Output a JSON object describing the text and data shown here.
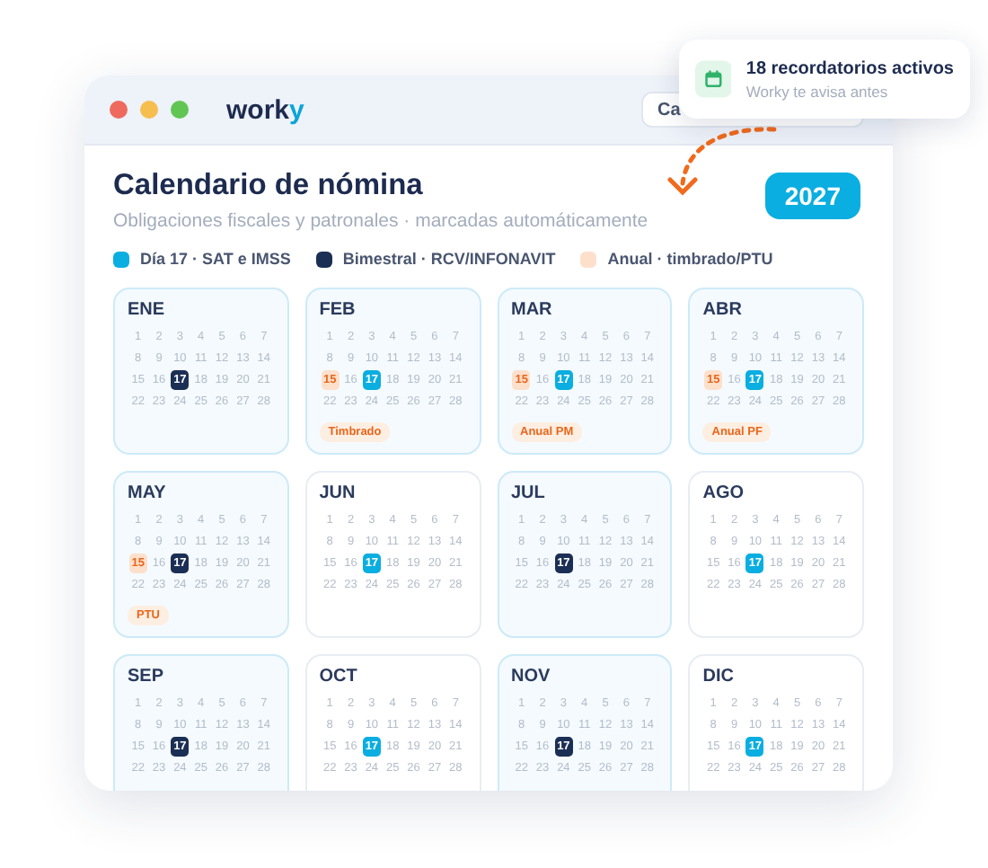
{
  "window": {
    "brand": "work",
    "brand_accent": "y",
    "search": {
      "value": "Ca"
    }
  },
  "toast": {
    "title": "18 recordatorios activos",
    "subtitle": "Worky te avisa antes"
  },
  "header": {
    "title": "Calendario de nómina",
    "subtitle": "Obligaciones fiscales y patronales · marcadas automáticamente",
    "year": "2027"
  },
  "legend": [
    {
      "kind": "monthly",
      "label": "Día 17 · SAT e IMSS"
    },
    {
      "kind": "bimestral",
      "label": "Bimestral · RCV/INFONAVIT"
    },
    {
      "kind": "annual",
      "label": "Anual · timbrado/PTU"
    }
  ],
  "months": [
    {
      "name": "ENE",
      "highlighted": true,
      "days": [
        "1",
        "2",
        "3",
        "4",
        "5",
        "6",
        "7",
        "8",
        "9",
        "10",
        "11",
        "12",
        "13",
        "14",
        "15",
        "16",
        {
          "day": "17",
          "kind": "bimestral"
        },
        "18",
        "19",
        "20",
        "21",
        "22",
        "23",
        "24",
        "25",
        "26",
        "27",
        "28"
      ]
    },
    {
      "name": "FEB",
      "highlighted": true,
      "tag": "Timbrado",
      "days": [
        "1",
        "2",
        "3",
        "4",
        "5",
        "6",
        "7",
        "8",
        "9",
        "10",
        "11",
        "12",
        "13",
        "14",
        {
          "day": "15",
          "kind": "annual"
        },
        "16",
        {
          "day": "17",
          "kind": "monthly"
        },
        "18",
        "19",
        "20",
        "21",
        "22",
        "23",
        "24",
        "25",
        "26",
        "27",
        "28"
      ]
    },
    {
      "name": "MAR",
      "highlighted": true,
      "tag": "Anual PM",
      "days": [
        "1",
        "2",
        "3",
        "4",
        "5",
        "6",
        "7",
        "8",
        "9",
        "10",
        "11",
        "12",
        "13",
        "14",
        {
          "day": "15",
          "kind": "annual"
        },
        "16",
        {
          "day": "17",
          "kind": "monthly"
        },
        "18",
        "19",
        "20",
        "21",
        "22",
        "23",
        "24",
        "25",
        "26",
        "27",
        "28"
      ]
    },
    {
      "name": "ABR",
      "highlighted": true,
      "tag": "Anual PF",
      "days": [
        "1",
        "2",
        "3",
        "4",
        "5",
        "6",
        "7",
        "8",
        "9",
        "10",
        "11",
        "12",
        "13",
        "14",
        {
          "day": "15",
          "kind": "annual"
        },
        "16",
        {
          "day": "17",
          "kind": "monthly"
        },
        "18",
        "19",
        "20",
        "21",
        "22",
        "23",
        "24",
        "25",
        "26",
        "27",
        "28"
      ]
    },
    {
      "name": "MAY",
      "highlighted": true,
      "tag": "PTU",
      "days": [
        "1",
        "2",
        "3",
        "4",
        "5",
        "6",
        "7",
        "8",
        "9",
        "10",
        "11",
        "12",
        "13",
        "14",
        {
          "day": "15",
          "kind": "annual"
        },
        "16",
        {
          "day": "17",
          "kind": "bimestral"
        },
        "18",
        "19",
        "20",
        "21",
        "22",
        "23",
        "24",
        "25",
        "26",
        "27",
        "28"
      ]
    },
    {
      "name": "JUN",
      "highlighted": false,
      "days": [
        "1",
        "2",
        "3",
        "4",
        "5",
        "6",
        "7",
        "8",
        "9",
        "10",
        "11",
        "12",
        "13",
        "14",
        "15",
        "16",
        {
          "day": "17",
          "kind": "monthly"
        },
        "18",
        "19",
        "20",
        "21",
        "22",
        "23",
        "24",
        "25",
        "26",
        "27",
        "28"
      ]
    },
    {
      "name": "JUL",
      "highlighted": true,
      "days": [
        "1",
        "2",
        "3",
        "4",
        "5",
        "6",
        "7",
        "8",
        "9",
        "10",
        "11",
        "12",
        "13",
        "14",
        "15",
        "16",
        {
          "day": "17",
          "kind": "bimestral"
        },
        "18",
        "19",
        "20",
        "21",
        "22",
        "23",
        "24",
        "25",
        "26",
        "27",
        "28"
      ]
    },
    {
      "name": "AGO",
      "highlighted": false,
      "days": [
        "1",
        "2",
        "3",
        "4",
        "5",
        "6",
        "7",
        "8",
        "9",
        "10",
        "11",
        "12",
        "13",
        "14",
        "15",
        "16",
        {
          "day": "17",
          "kind": "monthly"
        },
        "18",
        "19",
        "20",
        "21",
        "22",
        "23",
        "24",
        "25",
        "26",
        "27",
        "28"
      ]
    },
    {
      "name": "SEP",
      "highlighted": true,
      "days": [
        "1",
        "2",
        "3",
        "4",
        "5",
        "6",
        "7",
        "8",
        "9",
        "10",
        "11",
        "12",
        "13",
        "14",
        "15",
        "16",
        {
          "day": "17",
          "kind": "bimestral"
        },
        "18",
        "19",
        "20",
        "21",
        "22",
        "23",
        "24",
        "25",
        "26",
        "27",
        "28"
      ]
    },
    {
      "name": "OCT",
      "highlighted": false,
      "days": [
        "1",
        "2",
        "3",
        "4",
        "5",
        "6",
        "7",
        "8",
        "9",
        "10",
        "11",
        "12",
        "13",
        "14",
        "15",
        "16",
        {
          "day": "17",
          "kind": "monthly"
        },
        "18",
        "19",
        "20",
        "21",
        "22",
        "23",
        "24",
        "25",
        "26",
        "27",
        "28"
      ]
    },
    {
      "name": "NOV",
      "highlighted": true,
      "days": [
        "1",
        "2",
        "3",
        "4",
        "5",
        "6",
        "7",
        "8",
        "9",
        "10",
        "11",
        "12",
        "13",
        "14",
        "15",
        "16",
        {
          "day": "17",
          "kind": "bimestral"
        },
        "18",
        "19",
        "20",
        "21",
        "22",
        "23",
        "24",
        "25",
        "26",
        "27",
        "28"
      ]
    },
    {
      "name": "DIC",
      "highlighted": false,
      "days": [
        "1",
        "2",
        "3",
        "4",
        "5",
        "6",
        "7",
        "8",
        "9",
        "10",
        "11",
        "12",
        "13",
        "14",
        "15",
        "16",
        {
          "day": "17",
          "kind": "monthly"
        },
        "18",
        "19",
        "20",
        "21",
        "22",
        "23",
        "24",
        "25",
        "26",
        "27",
        "28"
      ]
    }
  ]
}
